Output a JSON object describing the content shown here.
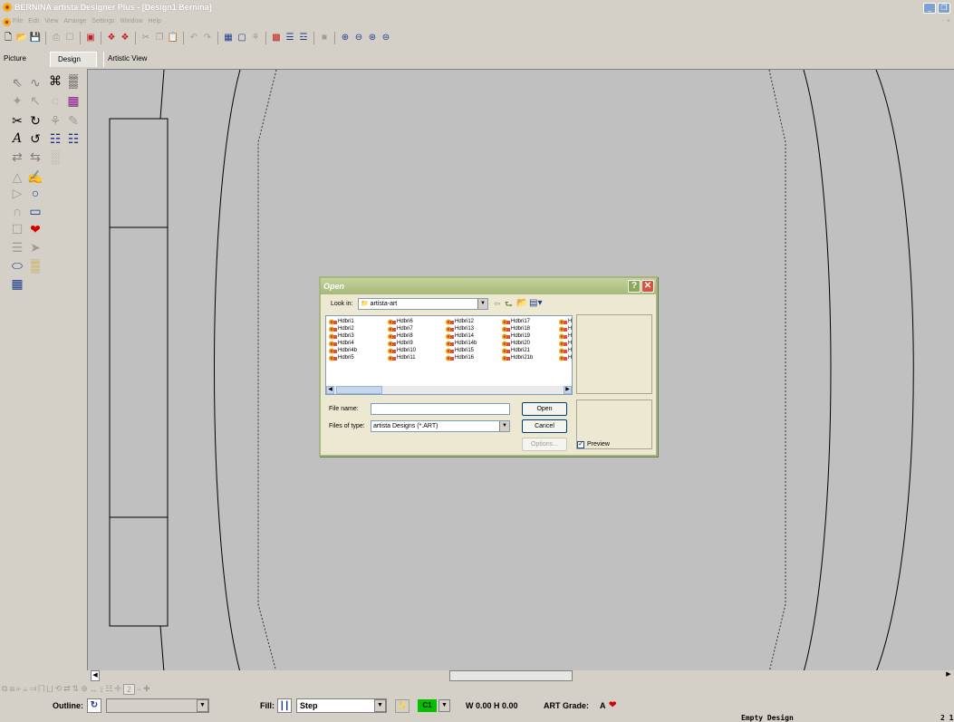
{
  "window": {
    "title": "BERNINA artista Designer Plus - [Design1       Bernina]",
    "menu": [
      "File",
      "Edit",
      "View",
      "Arrange",
      "Settings",
      "Window",
      "Help"
    ],
    "mdi_controls": "-  ×"
  },
  "tabs": [
    {
      "label": "Picture",
      "selected": false
    },
    {
      "label": "Design",
      "selected": true
    },
    {
      "label": "Artistic View",
      "selected": false
    }
  ],
  "dialog": {
    "title": "Open",
    "look_in_label": "Look in:",
    "look_in_value": "artista-art",
    "files": [
      [
        "Hdbri1",
        "Hdbri2",
        "Hdbri3",
        "Hdbri4",
        "Hdbri4b",
        "Hdbri5"
      ],
      [
        "Hdbri6",
        "Hdbri7",
        "Hdbri8",
        "Hdbri9",
        "Hdbri10",
        "Hdbri11"
      ],
      [
        "Hdbri12",
        "Hdbri13",
        "Hdbri14",
        "Hdbri14b",
        "Hdbri15",
        "Hdbri16"
      ],
      [
        "Hdbri17",
        "Hdbri18",
        "Hdbri19",
        "Hdbri20",
        "Hdbri21",
        "Hdbri21b"
      ],
      [
        "H",
        "H",
        "H",
        "H",
        "H",
        "H"
      ]
    ],
    "file_name_label": "File name:",
    "file_name_value": "",
    "files_of_type_label": "Files of type:",
    "files_of_type_value": "artista Designs (*.ART)",
    "open_button": "Open",
    "cancel_button": "Cancel",
    "options_button": "Options...",
    "preview_label": "Preview",
    "preview_checked": true
  },
  "bottom": {
    "outline_label": "Outline:",
    "fill_label": "Fill:",
    "fill_value": "Step",
    "color_value": "C1",
    "size_text": "W 0.00 H 0.00",
    "grade_label": "ART Grade:",
    "grade_value": "A",
    "zoom_field": "2"
  },
  "status": {
    "text": "Empty Design",
    "right": "2 1"
  },
  "colors": {
    "canvas": "#c0c0c0",
    "chrome": "#d4d0c8",
    "dialog_title": "#a7b97a",
    "close_button": "#d9533c",
    "heart": "#d40000",
    "color_chip": "#00c000"
  }
}
